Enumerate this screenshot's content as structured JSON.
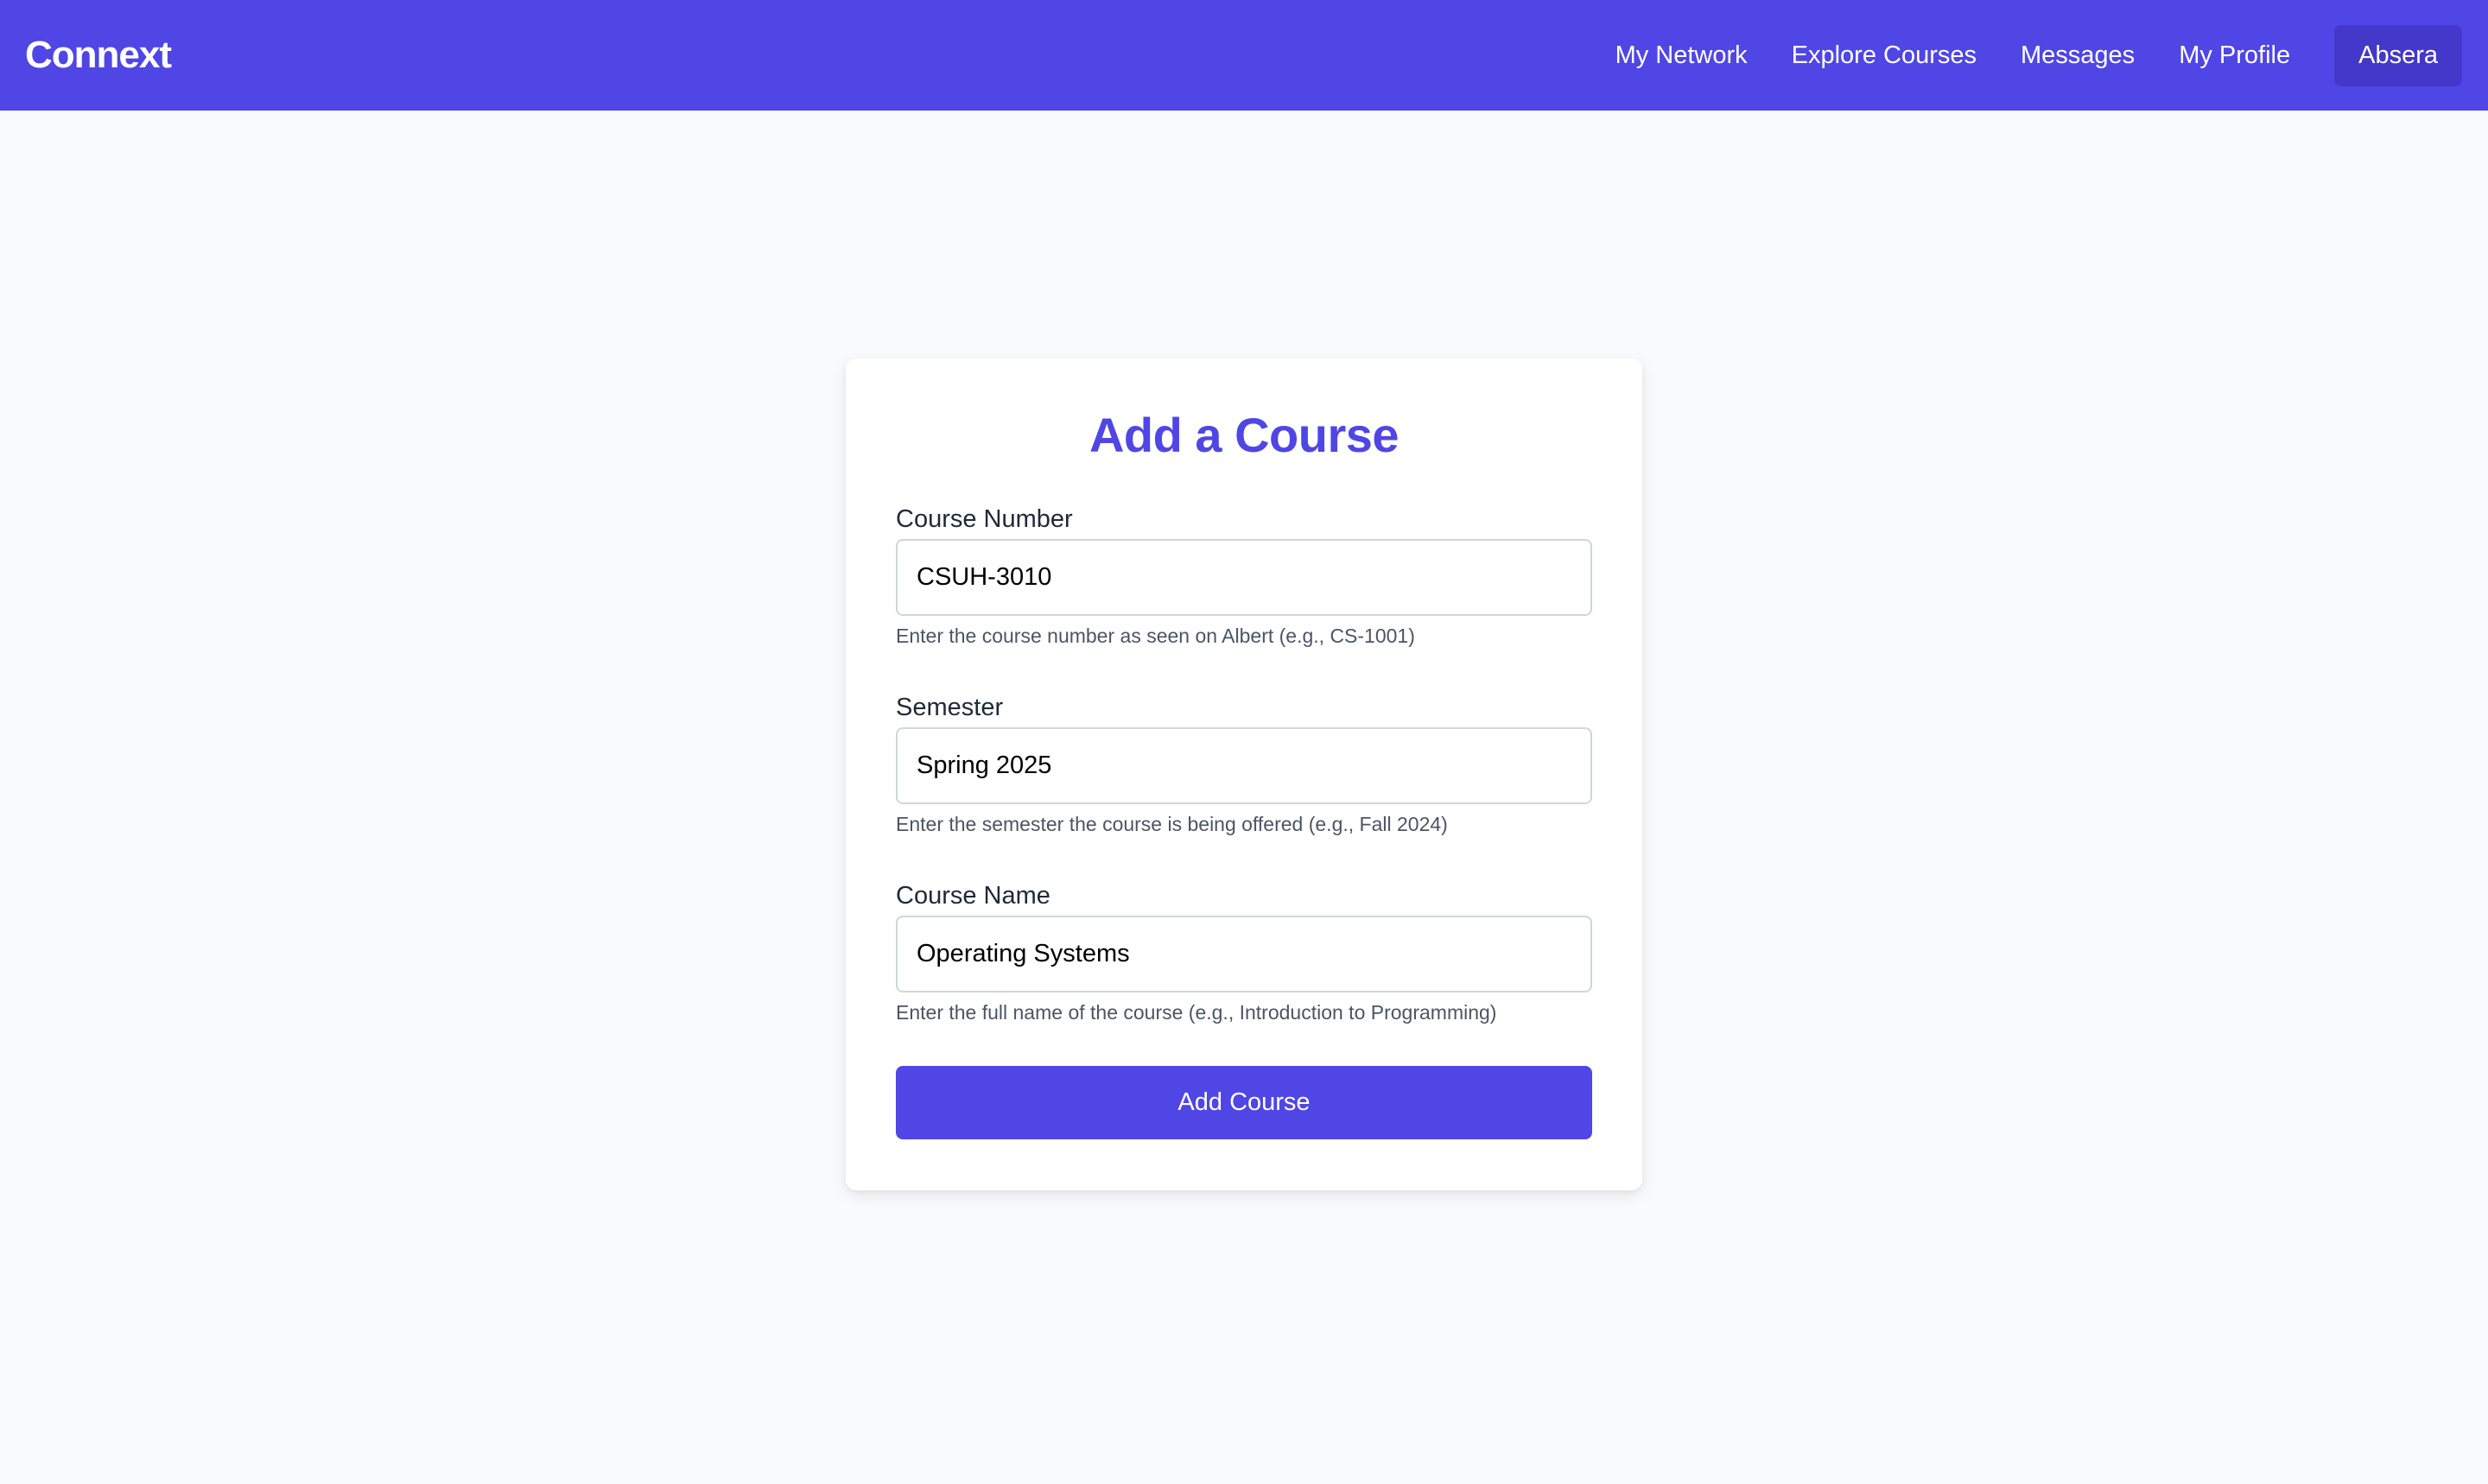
{
  "nav": {
    "brand": "Connext",
    "links": [
      "My Network",
      "Explore Courses",
      "Messages",
      "My Profile"
    ],
    "user_button": "Absera"
  },
  "form": {
    "title": "Add a Course",
    "fields": [
      {
        "label": "Course Number",
        "value": "CSUH-3010",
        "help": "Enter the course number as seen on Albert (e.g., CS-1001)"
      },
      {
        "label": "Semester",
        "value": "Spring 2025",
        "help": "Enter the semester the course is being offered (e.g., Fall 2024)"
      },
      {
        "label": "Course Name",
        "value": "Operating Systems",
        "help": "Enter the full name of the course (e.g., Introduction to Programming)"
      }
    ],
    "submit_label": "Add Course"
  },
  "colors": {
    "brand_primary": "#4f46e5",
    "brand_dark": "#4338ca",
    "page_background": "#f9fafb"
  }
}
